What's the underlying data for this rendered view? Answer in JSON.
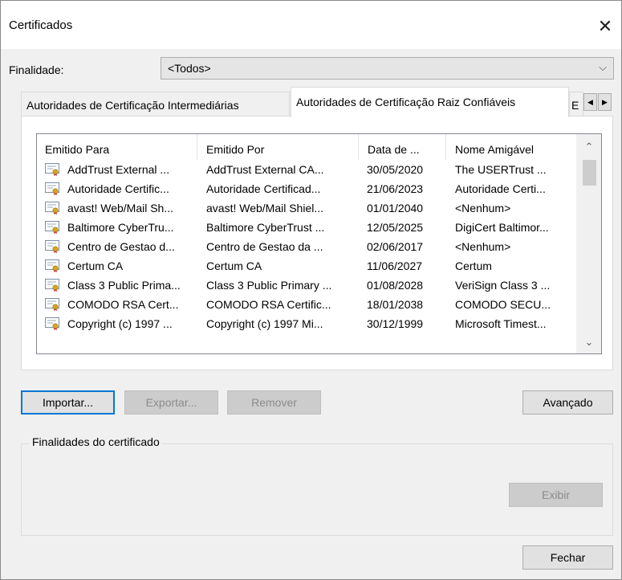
{
  "window": {
    "title": "Certificados",
    "close_glyph": "✕"
  },
  "purpose": {
    "label": "Finalidade:",
    "value": "<Todos>",
    "arrow": "⌵"
  },
  "tabs": [
    {
      "label": "Autoridades de Certificação Intermediárias",
      "active": false
    },
    {
      "label": "Autoridades de Certificação Raiz Confiáveis",
      "active": true
    },
    {
      "label": "E",
      "active": false
    }
  ],
  "tab_scroll": {
    "left": "◀",
    "right": "▶"
  },
  "list": {
    "columns": [
      "Emitido Para",
      "Emitido Por",
      "Data de ...",
      "Nome Amigável"
    ],
    "rows": [
      [
        "AddTrust External ...",
        "AddTrust External CA...",
        "30/05/2020",
        "The USERTrust ..."
      ],
      [
        "Autoridade Certific...",
        "Autoridade Certificad...",
        "21/06/2023",
        "Autoridade Certi..."
      ],
      [
        "avast! Web/Mail Sh...",
        "avast! Web/Mail Shiel...",
        "01/01/2040",
        "<Nenhum>"
      ],
      [
        "Baltimore CyberTru...",
        "Baltimore CyberTrust ...",
        "12/05/2025",
        "DigiCert Baltimor..."
      ],
      [
        "Centro de Gestao d...",
        "Centro de Gestao da ...",
        "02/06/2017",
        "<Nenhum>"
      ],
      [
        "Certum CA",
        "Certum CA",
        "11/06/2027",
        "Certum"
      ],
      [
        "Class 3 Public Prima...",
        "Class 3 Public Primary ...",
        "01/08/2028",
        "VeriSign Class 3 ..."
      ],
      [
        "COMODO RSA Cert...",
        "COMODO RSA Certific...",
        "18/01/2038",
        "COMODO SECU..."
      ],
      [
        "Copyright (c) 1997 ...",
        "Copyright (c) 1997 Mi...",
        "30/12/1999",
        "Microsoft Timest..."
      ]
    ],
    "scroll_up": "⌃",
    "scroll_down": "⌄",
    "row_icon": "certificate-icon"
  },
  "buttons": {
    "import": "Importar...",
    "export": "Exportar...",
    "remove": "Remover",
    "advanced": "Avançado",
    "view": "Exibir",
    "close": "Fechar"
  },
  "purposes_group": {
    "label": "Finalidades do certificado"
  },
  "colors": {
    "focus_border": "#0078d7",
    "window_bg": "#f0f0f0",
    "cert_gold": "#d9a520"
  }
}
